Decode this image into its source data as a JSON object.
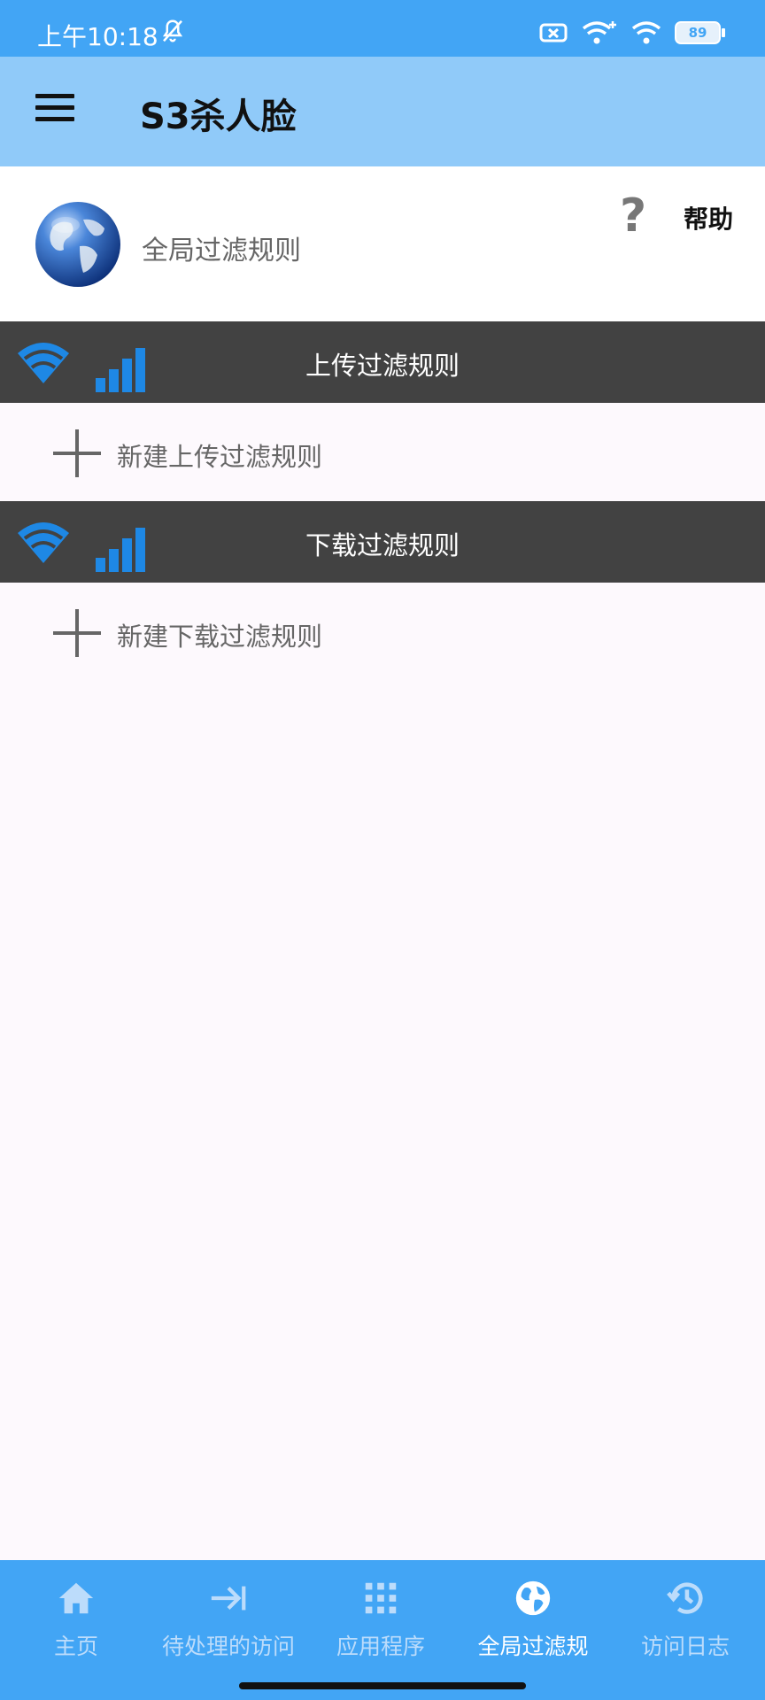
{
  "status_bar": {
    "time": "上午10:18",
    "battery": "89"
  },
  "app_bar": {
    "title": "S3杀人脸",
    "menu_icon": "hamburger-menu-icon"
  },
  "header": {
    "label": "全局过滤规则",
    "help_label": "帮助",
    "help_glyph": "?",
    "icon": "globe-icon"
  },
  "upload_section": {
    "title": "上传过滤规则",
    "add_label": "新建上传过滤规则"
  },
  "download_section": {
    "title": "下载过滤规则",
    "add_label": "新建下载过滤规则"
  },
  "bottom_nav": {
    "items": [
      {
        "label": "主页",
        "icon": "home-icon"
      },
      {
        "label": "待处理的访问",
        "icon": "arrow-to-bar-icon"
      },
      {
        "label": "应用程序",
        "icon": "apps-grid-icon"
      },
      {
        "label": "全局过滤规",
        "icon": "globe-icon",
        "active": true
      },
      {
        "label": "访问日志",
        "icon": "history-icon"
      }
    ]
  },
  "colors": {
    "status_bar": "#42a5f5",
    "app_bar": "#90caf9",
    "section_bar": "#424242",
    "accent_blue": "#1e88e5",
    "bottom_nav": "#42a5f5"
  }
}
